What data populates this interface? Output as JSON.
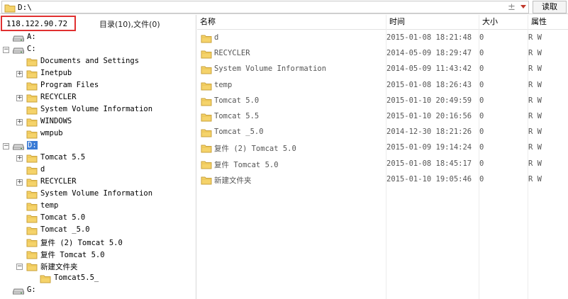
{
  "address": {
    "path": "D:\\",
    "read_button": "读取",
    "add_glyph": "±"
  },
  "left": {
    "ip": "118.122.90.72",
    "summary": "目录(10),文件(0)",
    "tree": [
      {
        "label": "A:",
        "type": "drive",
        "level": 0,
        "expander": ""
      },
      {
        "label": "C:",
        "type": "drive",
        "level": 0,
        "expander": "−"
      },
      {
        "label": "Documents and Settings",
        "type": "folder",
        "level": 1,
        "expander": ""
      },
      {
        "label": "Inetpub",
        "type": "folder",
        "level": 1,
        "expander": "+"
      },
      {
        "label": "Program Files",
        "type": "folder",
        "level": 1,
        "expander": ""
      },
      {
        "label": "RECYCLER",
        "type": "folder",
        "level": 1,
        "expander": "+"
      },
      {
        "label": "System Volume Information",
        "type": "folder",
        "level": 1,
        "expander": ""
      },
      {
        "label": "WINDOWS",
        "type": "folder",
        "level": 1,
        "expander": "+"
      },
      {
        "label": "wmpub",
        "type": "folder",
        "level": 1,
        "expander": ""
      },
      {
        "label": "D:",
        "type": "drive",
        "level": 0,
        "expander": "−",
        "selected": true
      },
      {
        "label": "Tomcat 5.5",
        "type": "folder",
        "level": 1,
        "expander": "+"
      },
      {
        "label": "d",
        "type": "folder",
        "level": 1,
        "expander": ""
      },
      {
        "label": "RECYCLER",
        "type": "folder",
        "level": 1,
        "expander": "+"
      },
      {
        "label": "System Volume Information",
        "type": "folder",
        "level": 1,
        "expander": ""
      },
      {
        "label": "temp",
        "type": "folder",
        "level": 1,
        "expander": ""
      },
      {
        "label": "Tomcat 5.0",
        "type": "folder",
        "level": 1,
        "expander": ""
      },
      {
        "label": "Tomcat _5.0",
        "type": "folder",
        "level": 1,
        "expander": ""
      },
      {
        "label": "复件 (2) Tomcat 5.0",
        "type": "folder",
        "level": 1,
        "expander": ""
      },
      {
        "label": "复件 Tomcat 5.0",
        "type": "folder",
        "level": 1,
        "expander": ""
      },
      {
        "label": "新建文件夹",
        "type": "folder",
        "level": 1,
        "expander": "−"
      },
      {
        "label": "Tomcat5.5_",
        "type": "folder",
        "level": 2,
        "expander": ""
      },
      {
        "label": "G:",
        "type": "drive",
        "level": 0,
        "expander": ""
      }
    ]
  },
  "right": {
    "columns": [
      "名称",
      "时间",
      "大小",
      "属性"
    ],
    "rows": [
      {
        "name": "d",
        "time": "2015-01-08 18:21:48",
        "size": "0",
        "attr": "R W"
      },
      {
        "name": "RECYCLER",
        "time": "2014-05-09 18:29:47",
        "size": "0",
        "attr": "R W"
      },
      {
        "name": "System Volume Information",
        "time": "2014-05-09 11:43:42",
        "size": "0",
        "attr": "R W"
      },
      {
        "name": "temp",
        "time": "2015-01-08 18:26:43",
        "size": "0",
        "attr": "R W"
      },
      {
        "name": "Tomcat 5.0",
        "time": "2015-01-10 20:49:59",
        "size": "0",
        "attr": "R W"
      },
      {
        "name": "Tomcat 5.5",
        "time": "2015-01-10 20:16:56",
        "size": "0",
        "attr": "R W"
      },
      {
        "name": "Tomcat _5.0",
        "time": "2014-12-30 18:21:26",
        "size": "0",
        "attr": "R W"
      },
      {
        "name": "复件 (2) Tomcat 5.0",
        "time": "2015-01-09 19:14:24",
        "size": "0",
        "attr": "R W"
      },
      {
        "name": "复件 Tomcat 5.0",
        "time": "2015-01-08 18:45:17",
        "size": "0",
        "attr": "R W"
      },
      {
        "name": "新建文件夹",
        "time": "2015-01-10 19:05:46",
        "size": "0",
        "attr": "R W"
      }
    ]
  },
  "colors": {
    "folder": "#f5d36a",
    "folder_edge": "#c9a13a",
    "highlight": "#e03030",
    "selection": "#3a7bd5"
  }
}
